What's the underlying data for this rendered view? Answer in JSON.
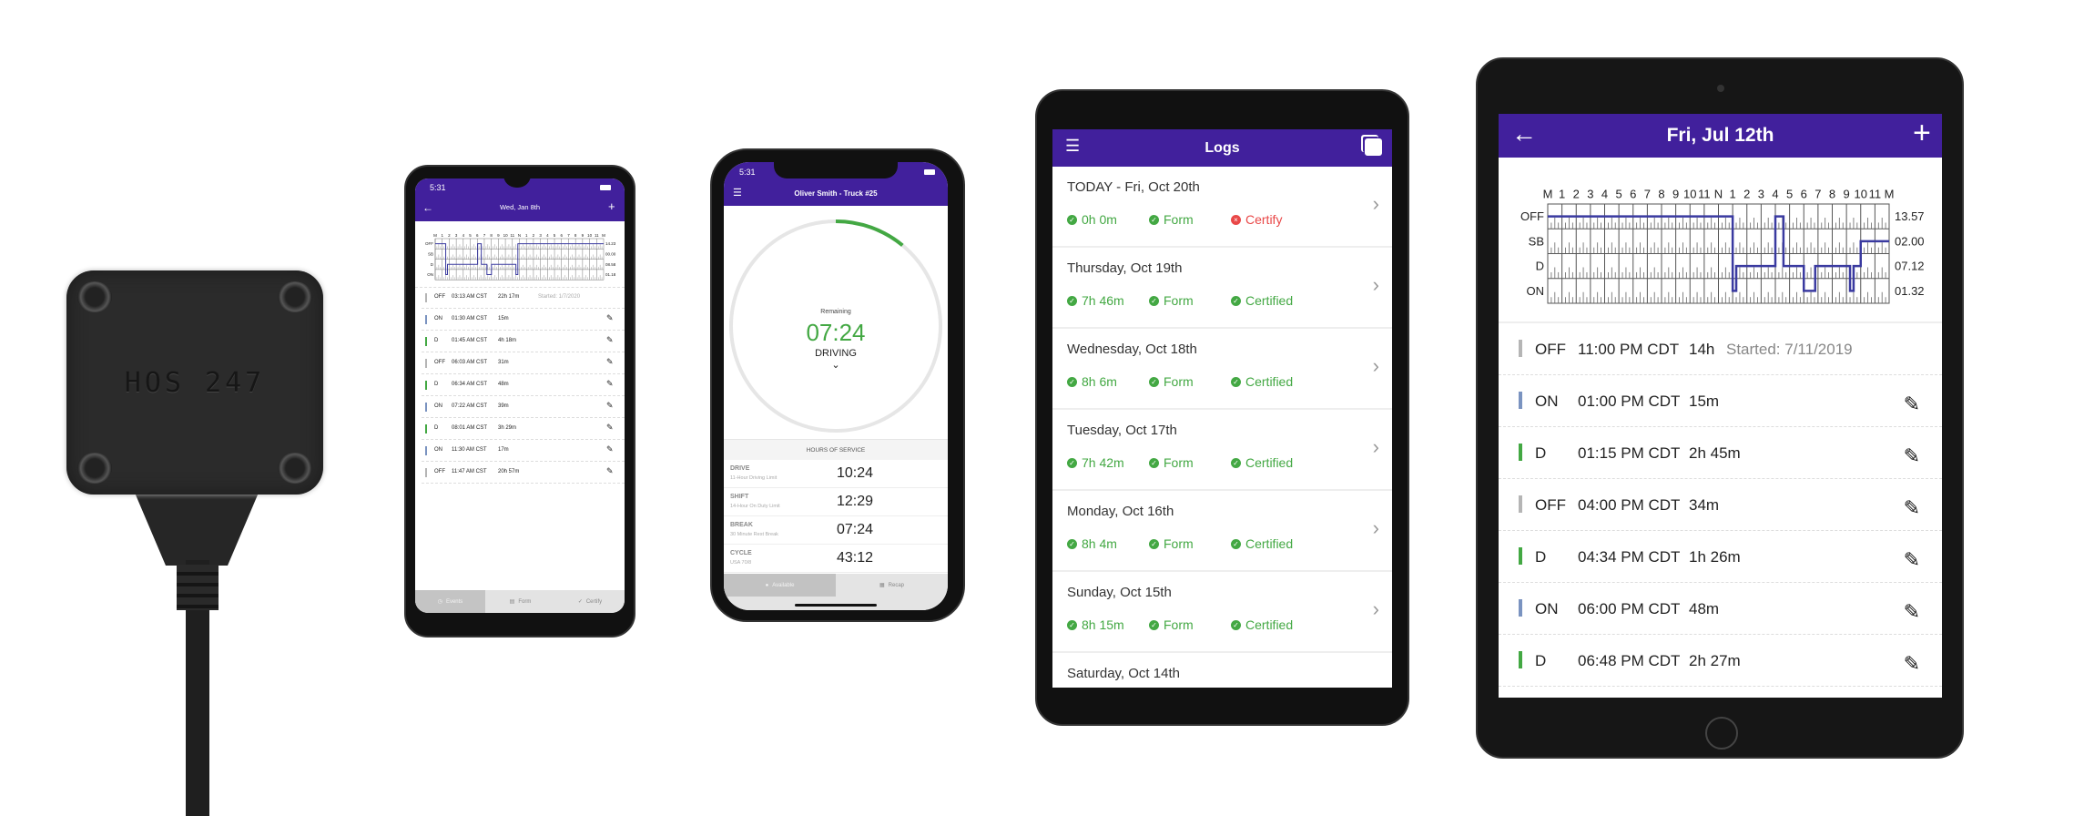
{
  "device": {
    "label": "HOS 247"
  },
  "phone_android": {
    "status_time": "5:31",
    "title": "Wed, Jan 8th",
    "events": [
      {
        "status": "OFF",
        "time": "03:13 AM CST",
        "duration": "22h 17m",
        "note": "Started: 1/7/2020",
        "editable": false
      },
      {
        "status": "ON",
        "time": "01:30 AM CST",
        "duration": "15m",
        "editable": true
      },
      {
        "status": "D",
        "time": "01:45 AM CST",
        "duration": "4h 18m",
        "editable": true
      },
      {
        "status": "OFF",
        "time": "06:03 AM CST",
        "duration": "31m",
        "editable": true
      },
      {
        "status": "D",
        "time": "06:34 AM CST",
        "duration": "48m",
        "editable": true
      },
      {
        "status": "ON",
        "time": "07:22 AM CST",
        "duration": "39m",
        "editable": true
      },
      {
        "status": "D",
        "time": "08:01 AM CST",
        "duration": "3h 29m",
        "editable": true
      },
      {
        "status": "ON",
        "time": "11:30 AM CST",
        "duration": "17m",
        "editable": true
      },
      {
        "status": "OFF",
        "time": "11:47 AM CST",
        "duration": "20h 57m",
        "editable": true
      }
    ],
    "tabs": [
      {
        "label": "Events",
        "icon": "clock-icon",
        "active": true
      },
      {
        "label": "Form",
        "icon": "form-icon"
      },
      {
        "label": "Certify",
        "icon": "check-circle-icon"
      }
    ]
  },
  "phone_iphone": {
    "status_time": "5:31",
    "title": "Oliver Smith - Truck #25",
    "gauge": {
      "label": "Remaining",
      "value": "07:24",
      "status": "DRIVING",
      "progress_fraction": 0.11
    },
    "hos_header": "HOURS OF SERVICE",
    "hos": [
      {
        "name": "DRIVE",
        "sub": "11-Hour Driving Limit",
        "value": "10:24"
      },
      {
        "name": "SHIFT",
        "sub": "14-Hour On Duty Limit",
        "value": "12:29"
      },
      {
        "name": "BREAK",
        "sub": "30 Minute Rest Break",
        "value": "07:24"
      },
      {
        "name": "CYCLE",
        "sub": "USA 70/8",
        "value": "43:12"
      }
    ],
    "tabs": [
      {
        "label": "Available",
        "active": true
      },
      {
        "label": "Recap"
      }
    ]
  },
  "tablet_logs": {
    "title": "Logs",
    "days": [
      {
        "title": "TODAY - Fri, Oct 20th",
        "hours": "0h 0m",
        "form": "Form",
        "certify": "Certify",
        "certified": false
      },
      {
        "title": "Thursday, Oct 19th",
        "hours": "7h 46m",
        "form": "Form",
        "certify": "Certified",
        "certified": true
      },
      {
        "title": "Wednesday, Oct 18th",
        "hours": "8h 6m",
        "form": "Form",
        "certify": "Certified",
        "certified": true
      },
      {
        "title": "Tuesday, Oct 17th",
        "hours": "7h 42m",
        "form": "Form",
        "certify": "Certified",
        "certified": true
      },
      {
        "title": "Monday, Oct 16th",
        "hours": "8h 4m",
        "form": "Form",
        "certify": "Certified",
        "certified": true
      },
      {
        "title": "Sunday, Oct 15th",
        "hours": "8h 15m",
        "form": "Form",
        "certify": "Certified",
        "certified": true
      },
      {
        "title": "Saturday, Oct 14th"
      }
    ]
  },
  "tablet_day": {
    "title": "Fri, Jul 12th",
    "events": [
      {
        "status": "OFF",
        "time": "11:00 PM CDT",
        "duration": "14h",
        "note": "Started: 7/11/2019",
        "editable": false
      },
      {
        "status": "ON",
        "time": "01:00 PM CDT",
        "duration": "15m",
        "editable": true
      },
      {
        "status": "D",
        "time": "01:15 PM CDT",
        "duration": "2h 45m",
        "editable": true
      },
      {
        "status": "OFF",
        "time": "04:00 PM CDT",
        "duration": "34m",
        "editable": true
      },
      {
        "status": "D",
        "time": "04:34 PM CDT",
        "duration": "1h 26m",
        "editable": true
      },
      {
        "status": "ON",
        "time": "06:00 PM CDT",
        "duration": "48m",
        "editable": true
      },
      {
        "status": "D",
        "time": "06:48 PM CDT",
        "duration": "2h 27m",
        "editable": true
      }
    ]
  },
  "colors": {
    "brand": "#41209c",
    "driving": "#43a843",
    "on_duty": "#7a93c0",
    "off_duty": "#b5b5b5",
    "error": "#e94848",
    "line": "#3a3aa0"
  },
  "chart_data": [
    {
      "type": "line",
      "id": "android-log-grid",
      "hour_labels": [
        "M",
        "1",
        "2",
        "3",
        "4",
        "5",
        "6",
        "7",
        "8",
        "9",
        "10",
        "11",
        "N",
        "1",
        "2",
        "3",
        "4",
        "5",
        "6",
        "7",
        "8",
        "9",
        "10",
        "11",
        "M"
      ],
      "rows": [
        "OFF",
        "SB",
        "D",
        "ON"
      ],
      "totals": [
        "14.23",
        "00.00",
        "08.58",
        "01.18"
      ],
      "segments": [
        [
          "OFF",
          0,
          1.5
        ],
        [
          "ON",
          1.5,
          1.75
        ],
        [
          "D",
          1.75,
          6.05
        ],
        [
          "OFF",
          6.05,
          6.57
        ],
        [
          "D",
          6.57,
          7.37
        ],
        [
          "ON",
          7.37,
          8.02
        ],
        [
          "D",
          8.02,
          11.5
        ],
        [
          "ON",
          11.5,
          11.78
        ],
        [
          "OFF",
          11.78,
          24
        ]
      ]
    },
    {
      "type": "line",
      "id": "tablet-log-grid",
      "hour_labels": [
        "M",
        "1",
        "2",
        "3",
        "4",
        "5",
        "6",
        "7",
        "8",
        "9",
        "10",
        "11",
        "N",
        "1",
        "2",
        "3",
        "4",
        "5",
        "6",
        "7",
        "8",
        "9",
        "10",
        "11",
        "M"
      ],
      "rows": [
        "OFF",
        "SB",
        "D",
        "ON"
      ],
      "totals": [
        "13.57",
        "02.00",
        "07.12",
        "01.32"
      ],
      "segments": [
        [
          "OFF",
          0,
          13
        ],
        [
          "ON",
          13,
          13.25
        ],
        [
          "D",
          13.25,
          16
        ],
        [
          "OFF",
          16,
          16.57
        ],
        [
          "D",
          16.57,
          18
        ],
        [
          "ON",
          18,
          18.8
        ],
        [
          "D",
          18.8,
          21.25
        ],
        [
          "ON",
          21.25,
          21.5
        ],
        [
          "D",
          21.5,
          22
        ],
        [
          "SB",
          22,
          24
        ]
      ]
    }
  ]
}
